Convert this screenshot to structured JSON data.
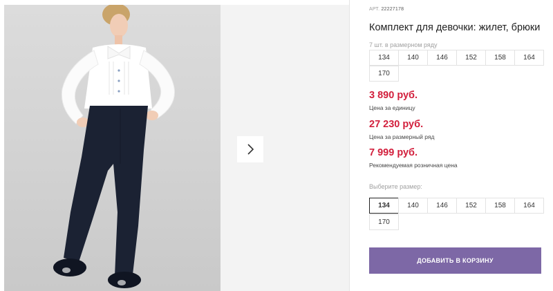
{
  "gallery": {
    "next_icon": "chevron-right-icon"
  },
  "product": {
    "sku_label": "АРТ.",
    "sku_value": "22227178",
    "title": "Комплект для девочки: жилет, брюки",
    "pack_caption": "7 шт. в размерном ряду",
    "pack_sizes": [
      "134",
      "140",
      "146",
      "152",
      "158",
      "164",
      "170"
    ],
    "prices": [
      {
        "value": "3 890 руб.",
        "note": "Цена за единицу"
      },
      {
        "value": "27 230 руб.",
        "note": "Цена за размерный ряд"
      },
      {
        "value": "7 999 руб.",
        "note": "Рекомендуемая розничная цена"
      }
    ],
    "price_color": "#d21f3c",
    "select_caption": "Выберите размер:",
    "select_sizes": [
      "134",
      "140",
      "146",
      "152",
      "158",
      "164",
      "170"
    ],
    "selected_size": "134",
    "add_to_cart_label": "ДОБАВИТЬ В КОРЗИНУ",
    "button_color": "#7d68a6"
  }
}
